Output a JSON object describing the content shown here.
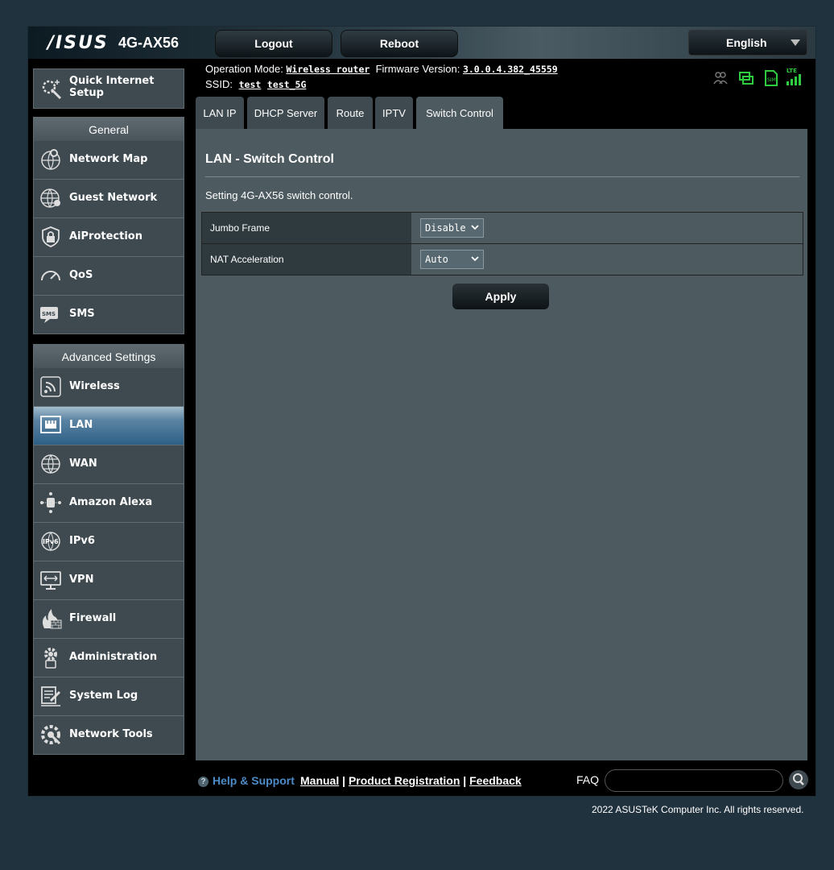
{
  "header": {
    "brand": "/ISUS",
    "model": "4G-AX56",
    "logout": "Logout",
    "reboot": "Reboot",
    "language": "English",
    "op_mode_label": "Operation Mode:",
    "op_mode_value": "Wireless router",
    "firmware_label": "Firmware Version:",
    "firmware_value": "3.0.0.4.382_45559",
    "ssid_label": "SSID:",
    "ssid_1": "test",
    "ssid_2": "test_5G",
    "lte_label": "LTE",
    "sim_label": "SIM"
  },
  "sidebar": {
    "qis": "Quick Internet Setup",
    "general_title": "General",
    "general": [
      {
        "label": "Network Map",
        "icon": "network-map-icon"
      },
      {
        "label": "Guest Network",
        "icon": "globe-icon"
      },
      {
        "label": "AiProtection",
        "icon": "lock-shield-icon"
      },
      {
        "label": "QoS",
        "icon": "gauge-icon"
      },
      {
        "label": "SMS",
        "icon": "sms-icon"
      }
    ],
    "advanced_title": "Advanced Settings",
    "advanced": [
      {
        "label": "Wireless",
        "icon": "wifi-icon"
      },
      {
        "label": "LAN",
        "icon": "lan-icon",
        "active": true
      },
      {
        "label": "WAN",
        "icon": "globe-icon"
      },
      {
        "label": "Amazon Alexa",
        "icon": "alexa-icon"
      },
      {
        "label": "IPv6",
        "icon": "ipv6-icon"
      },
      {
        "label": "VPN",
        "icon": "vpn-icon"
      },
      {
        "label": "Firewall",
        "icon": "firewall-icon"
      },
      {
        "label": "Administration",
        "icon": "gear-icon"
      },
      {
        "label": "System Log",
        "icon": "log-icon"
      },
      {
        "label": "Network Tools",
        "icon": "tools-icon"
      }
    ],
    "ipv6_badge": "IPv6",
    "sms_badge": "SMS"
  },
  "tabs": [
    "LAN IP",
    "DHCP Server",
    "Route",
    "IPTV",
    "Switch Control"
  ],
  "main": {
    "title": "LAN - Switch Control",
    "description": "Setting 4G-AX56 switch control.",
    "rows": [
      {
        "label": "Jumbo Frame",
        "value": "Disable"
      },
      {
        "label": "NAT Acceleration",
        "value": "Auto"
      }
    ],
    "apply": "Apply"
  },
  "footer": {
    "help": "Help & Support",
    "manual": "Manual",
    "sep": "|",
    "product_registration": "Product Registration",
    "feedback": "Feedback",
    "faq": "FAQ",
    "copyright": "2022 ASUSTeK Computer Inc. All rights reserved."
  },
  "colors": {
    "accent": "#4d8bc8",
    "active_menu": "#2d5f86",
    "status_green": "#2ecc40"
  }
}
